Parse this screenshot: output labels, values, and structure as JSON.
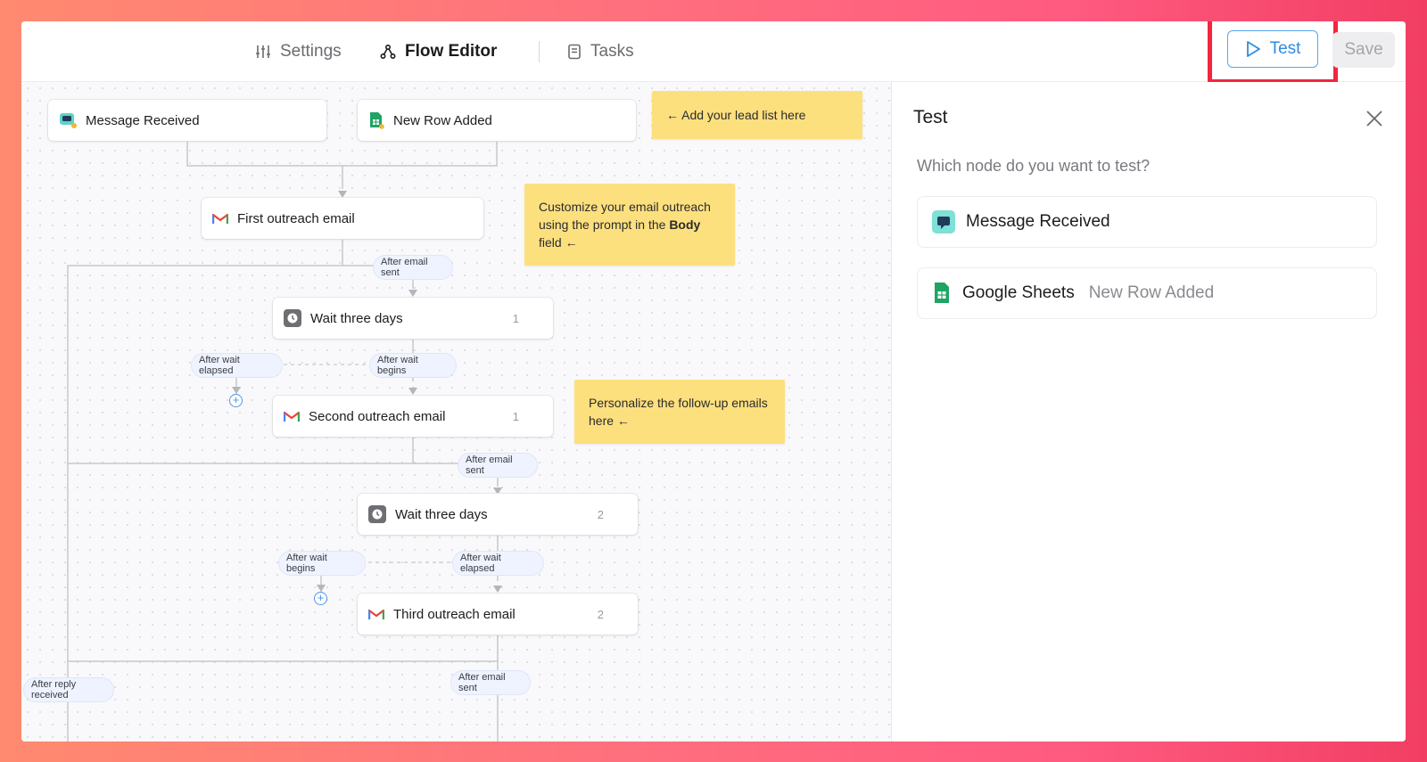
{
  "nav": {
    "settings_label": "Settings",
    "flow_editor_label": "Flow Editor",
    "tasks_label": "Tasks",
    "test_label": "Test",
    "save_label": "Save"
  },
  "flow": {
    "triggers": [
      {
        "label": "Message Received",
        "icon": "chat-icon"
      },
      {
        "label": "New Row Added",
        "icon": "google-sheets-icon"
      }
    ],
    "nodes": {
      "first_email": {
        "label": "First outreach email",
        "icon": "gmail-icon"
      },
      "wait_1": {
        "label": "Wait three days",
        "count": "1",
        "icon": "clock-icon"
      },
      "second_email": {
        "label": "Second outreach email",
        "count": "1",
        "icon": "gmail-icon"
      },
      "wait_2": {
        "label": "Wait three days",
        "count": "2",
        "icon": "clock-icon"
      },
      "third_email": {
        "label": "Third outreach email",
        "count": "2",
        "icon": "gmail-icon"
      }
    },
    "edge_labels": {
      "after_email_sent_1": "After email sent",
      "after_wait_elapsed_1": "After wait elapsed",
      "after_wait_begins_1": "After wait begins",
      "after_email_sent_2": "After email sent",
      "after_wait_begins_2": "After wait begins",
      "after_wait_elapsed_2": "After wait elapsed",
      "after_reply_received": "After reply received",
      "after_email_sent_3": "After email sent"
    },
    "notes": {
      "lead_list": "← Add your lead list here",
      "customize_prefix": "Customize your email outreach using the prompt in the ",
      "customize_bold": "Body",
      "customize_suffix": " field ←",
      "personalize": "Personalize the follow-up emails here ←"
    }
  },
  "panel": {
    "title": "Test",
    "question": "Which node do you want to test?",
    "options": [
      {
        "label": "Message Received",
        "sub": "",
        "icon": "chat-icon"
      },
      {
        "label": "Google Sheets",
        "sub": "New Row Added",
        "icon": "google-sheets-icon"
      }
    ]
  },
  "colors": {
    "accent_blue": "#2e8de0",
    "highlight_red": "#f2263f",
    "note_yellow": "#fde07e"
  }
}
